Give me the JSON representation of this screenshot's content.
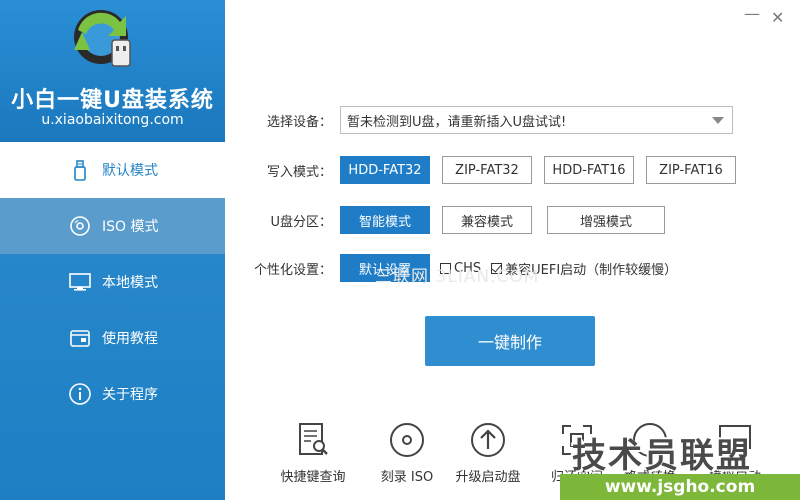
{
  "app": {
    "title": "小白一键U盘装系统",
    "url": "u.xiaobaixitong.com"
  },
  "window": {
    "min": "—",
    "close": "✕"
  },
  "sidebar": {
    "items": [
      {
        "label": "默认模式",
        "icon": "usb-drive-icon",
        "state": "active"
      },
      {
        "label": "ISO 模式",
        "icon": "disc-icon",
        "state": "hover"
      },
      {
        "label": "本地模式",
        "icon": "monitor-icon",
        "state": ""
      },
      {
        "label": "使用教程",
        "icon": "book-icon",
        "state": ""
      },
      {
        "label": "关于程序",
        "icon": "info-icon",
        "state": ""
      }
    ]
  },
  "form": {
    "device": {
      "label": "选择设备：",
      "value": "暂未检测到U盘，请重新插入U盘试试!"
    },
    "write_mode": {
      "label": "写入模式：",
      "options": [
        "HDD-FAT32",
        "ZIP-FAT32",
        "HDD-FAT16",
        "ZIP-FAT16"
      ],
      "selected": 0
    },
    "partition": {
      "label": "U盘分区：",
      "options": [
        "智能模式",
        "兼容模式",
        "增强模式"
      ],
      "selected": 0
    },
    "personal": {
      "label": "个性化设置：",
      "button": "默认设置",
      "chs": "CHS",
      "uefi": "兼容UEFI启动（制作较缓慢）",
      "uefi_checked": true,
      "chs_checked": false
    }
  },
  "watermark": "三联网 3LIAN.COM",
  "actions": {
    "make": "一键制作"
  },
  "toolbar": {
    "items": [
      {
        "label": "快捷键查询",
        "icon": "shortcut-doc-icon"
      },
      {
        "label": "刻录 ISO",
        "icon": "burn-disc-icon"
      },
      {
        "label": "升级启动盘",
        "icon": "upgrade-arrow-icon"
      },
      {
        "label": "归还空间",
        "icon": "restore-space-icon"
      },
      {
        "label": "格式转换",
        "icon": "convert-icon"
      },
      {
        "label": "模拟启动",
        "icon": "simulate-boot-icon"
      }
    ]
  },
  "corner_mark": {
    "title": "技术员联盟",
    "url": "www.jsgho.com"
  },
  "colors": {
    "accent": "#1e7dc6",
    "sidebar": "#2384c8",
    "green": "#7db83a"
  }
}
